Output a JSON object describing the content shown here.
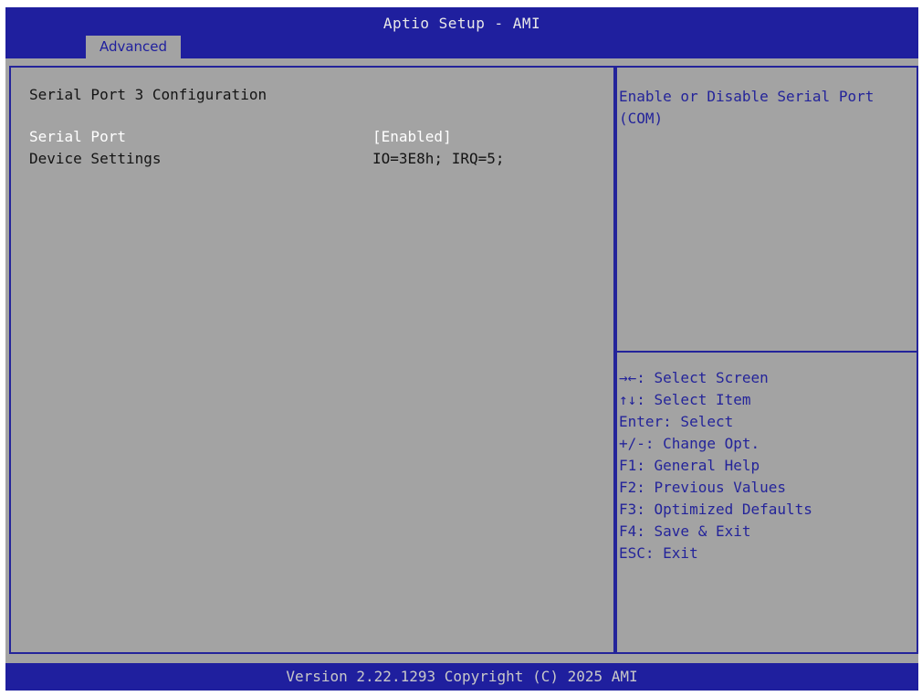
{
  "header": {
    "title": "Aptio Setup - AMI",
    "tabs": [
      {
        "label": "Advanced",
        "active": true
      }
    ]
  },
  "main": {
    "section_title": "Serial Port 3 Configuration",
    "settings": [
      {
        "label": "Serial Port",
        "value": "[Enabled]",
        "selected": true
      },
      {
        "label": "Device Settings",
        "value": "IO=3E8h; IRQ=5;",
        "selected": false
      }
    ]
  },
  "help": {
    "description": "Enable or Disable Serial Port (COM)",
    "keys": [
      "→←: Select Screen",
      "↑↓: Select Item",
      "Enter: Select",
      "+/-: Change Opt.",
      "F1: General Help",
      "F2: Previous Values",
      "F3: Optimized Defaults",
      "F4: Save & Exit",
      "ESC: Exit"
    ]
  },
  "footer": {
    "version": "Version 2.22.1293 Copyright (C) 2025 AMI"
  },
  "colors": {
    "bar_blue": "#1f1f9e",
    "panel_gray": "#a3a3a3",
    "border_blue": "#24249a",
    "selected_text": "#ffffff",
    "normal_text": "#141414"
  }
}
